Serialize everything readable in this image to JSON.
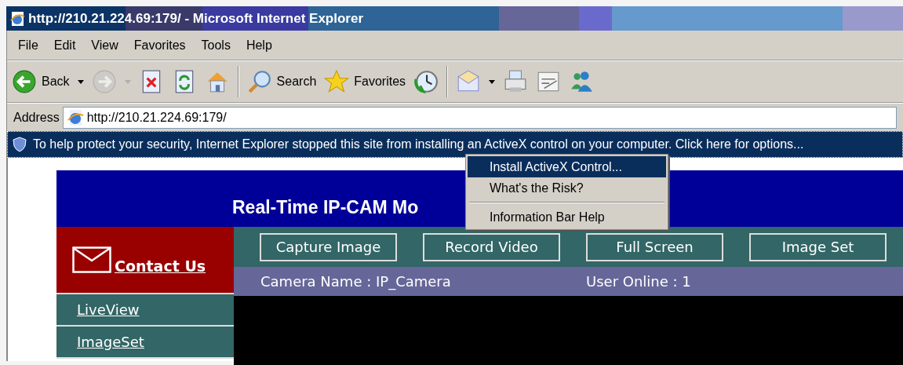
{
  "window": {
    "title": "http://210.21.224.69:179/ - Microsoft Internet Explorer"
  },
  "menu_bar": [
    "File",
    "Edit",
    "View",
    "Favorites",
    "Tools",
    "Help"
  ],
  "toolbar": [
    {
      "kind": "back",
      "label": "Back",
      "dropdown": true,
      "disabled": false
    },
    {
      "kind": "forward",
      "dropdown": true,
      "disabled": true
    },
    {
      "kind": "stop",
      "dropdown": false,
      "disabled": false
    },
    {
      "kind": "refresh",
      "dropdown": false,
      "disabled": false
    },
    {
      "kind": "home",
      "dropdown": false,
      "disabled": false
    },
    {
      "kind": "separator"
    },
    {
      "kind": "search",
      "label": "Search",
      "dropdown": false,
      "disabled": false
    },
    {
      "kind": "favorites",
      "label": "Favorites",
      "dropdown": false,
      "disabled": false
    },
    {
      "kind": "history",
      "dropdown": false,
      "disabled": false
    },
    {
      "kind": "separator"
    },
    {
      "kind": "mail",
      "dropdown": true,
      "disabled": false
    },
    {
      "kind": "print",
      "dropdown": false,
      "disabled": false
    },
    {
      "kind": "edit",
      "dropdown": false,
      "disabled": false
    },
    {
      "kind": "messenger",
      "dropdown": false,
      "disabled": false
    }
  ],
  "address_bar": {
    "label": "Address",
    "value": "http://210.21.224.69:179/"
  },
  "info_bar": {
    "text": "To help protect your security, Internet Explorer stopped this site from installing an ActiveX control on your computer. Click here for options..."
  },
  "context_menu": [
    {
      "kind": "item",
      "label": "Install ActiveX Control...",
      "selected": true
    },
    {
      "kind": "item",
      "label": "What's the Risk?",
      "selected": false
    },
    {
      "kind": "separator"
    },
    {
      "kind": "item",
      "label": "Information Bar Help",
      "selected": false
    }
  ],
  "page": {
    "title": "Real-Time IP-CAM Mo",
    "contact": "Contact Us",
    "nav": [
      "LiveView",
      "ImageSet"
    ],
    "buttons": [
      "Capture Image",
      "Record Video",
      "Full Screen",
      "Image Set"
    ],
    "camera_name": "Camera Name : IP_Camera",
    "user_online": "User Online : 1"
  }
}
